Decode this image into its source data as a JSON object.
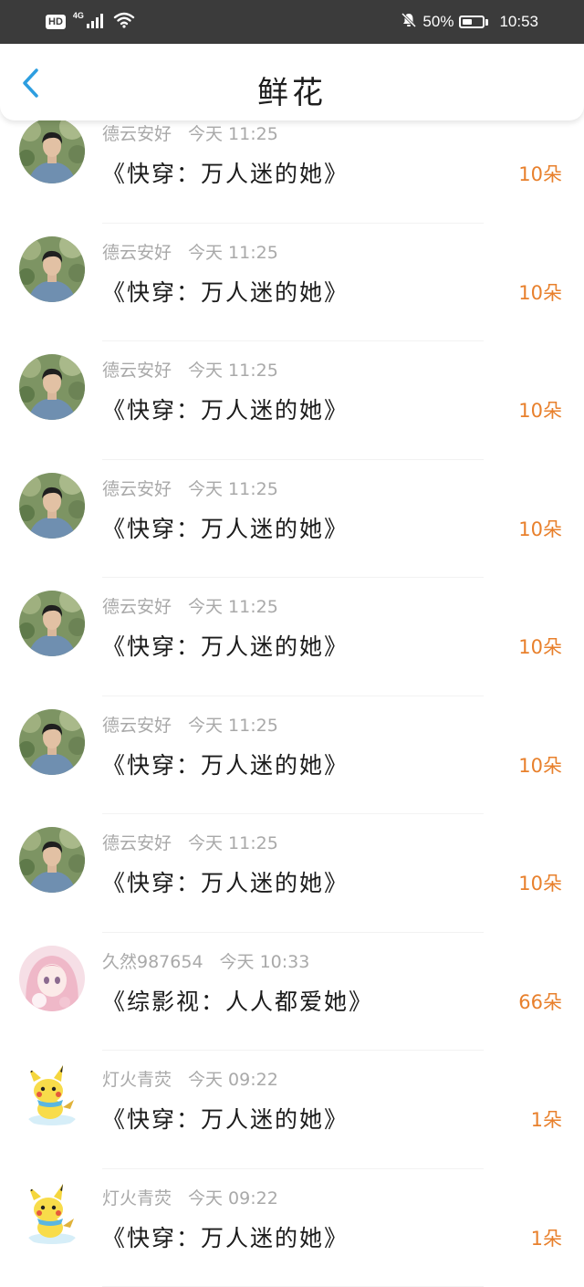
{
  "status_bar": {
    "hd": "HD",
    "network": "4G",
    "battery_percent": "50%",
    "battery_level": 0.5,
    "time": "10:53",
    "icons": [
      "signal-icon",
      "wifi-icon",
      "bell-muted-icon",
      "battery-icon"
    ]
  },
  "header": {
    "title": "鲜花",
    "back_icon": "chevron-left-icon",
    "accent_color": "#2d9ee0"
  },
  "accent_count_color": "#e8802c",
  "entries": [
    {
      "user": "德云安好",
      "time": "今天 11:25",
      "book": "《快穿：万人迷的她》",
      "count": "10朵",
      "avatar": "man-photo"
    },
    {
      "user": "德云安好",
      "time": "今天 11:25",
      "book": "《快穿：万人迷的她》",
      "count": "10朵",
      "avatar": "man-photo"
    },
    {
      "user": "德云安好",
      "time": "今天 11:25",
      "book": "《快穿：万人迷的她》",
      "count": "10朵",
      "avatar": "man-photo"
    },
    {
      "user": "德云安好",
      "time": "今天 11:25",
      "book": "《快穿：万人迷的她》",
      "count": "10朵",
      "avatar": "man-photo"
    },
    {
      "user": "德云安好",
      "time": "今天 11:25",
      "book": "《快穿：万人迷的她》",
      "count": "10朵",
      "avatar": "man-photo"
    },
    {
      "user": "德云安好",
      "time": "今天 11:25",
      "book": "《快穿：万人迷的她》",
      "count": "10朵",
      "avatar": "man-photo"
    },
    {
      "user": "德云安好",
      "time": "今天 11:25",
      "book": "《快穿：万人迷的她》",
      "count": "10朵",
      "avatar": "man-photo"
    },
    {
      "user": "久然987654",
      "time": "今天 10:33",
      "book": "《综影视：人人都爱她》",
      "count": "66朵",
      "avatar": "anime-girl"
    },
    {
      "user": "灯火青荧",
      "time": "今天 09:22",
      "book": "《快穿：万人迷的她》",
      "count": "1朵",
      "avatar": "pikachu"
    },
    {
      "user": "灯火青荧",
      "time": "今天 09:22",
      "book": "《快穿：万人迷的她》",
      "count": "1朵",
      "avatar": "pikachu"
    }
  ]
}
